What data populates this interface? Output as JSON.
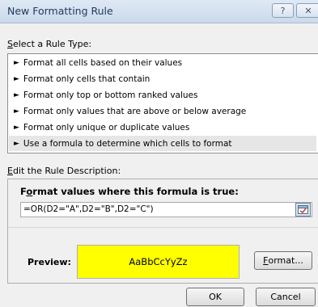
{
  "window": {
    "title": "New Formatting Rule",
    "help_glyph": "?",
    "close_glyph": "✕"
  },
  "rule_type": {
    "label_key": "S",
    "label_rest": "elect a Rule Type:",
    "items": [
      "Format all cells based on their values",
      "Format only cells that contain",
      "Format only top or bottom ranked values",
      "Format only values that are above or below average",
      "Format only unique or duplicate values",
      "Use a formula to determine which cells to format"
    ],
    "selected_index": 5
  },
  "description": {
    "label_key": "E",
    "label_rest": "dit the Rule Description:",
    "formula_header_pre": "F",
    "formula_header_key": "o",
    "formula_header_rest": "rmat values where this formula is true:",
    "formula_value": "=OR(D2=\"A\",D2=\"B\",D2=\"C\")",
    "preview_label": "Preview:",
    "preview_text": "AaBbCcYyZz",
    "preview_fill": "#ffff00",
    "format_key": "F",
    "format_rest": "ormat..."
  },
  "buttons": {
    "ok": "OK",
    "cancel": "Cancel"
  }
}
